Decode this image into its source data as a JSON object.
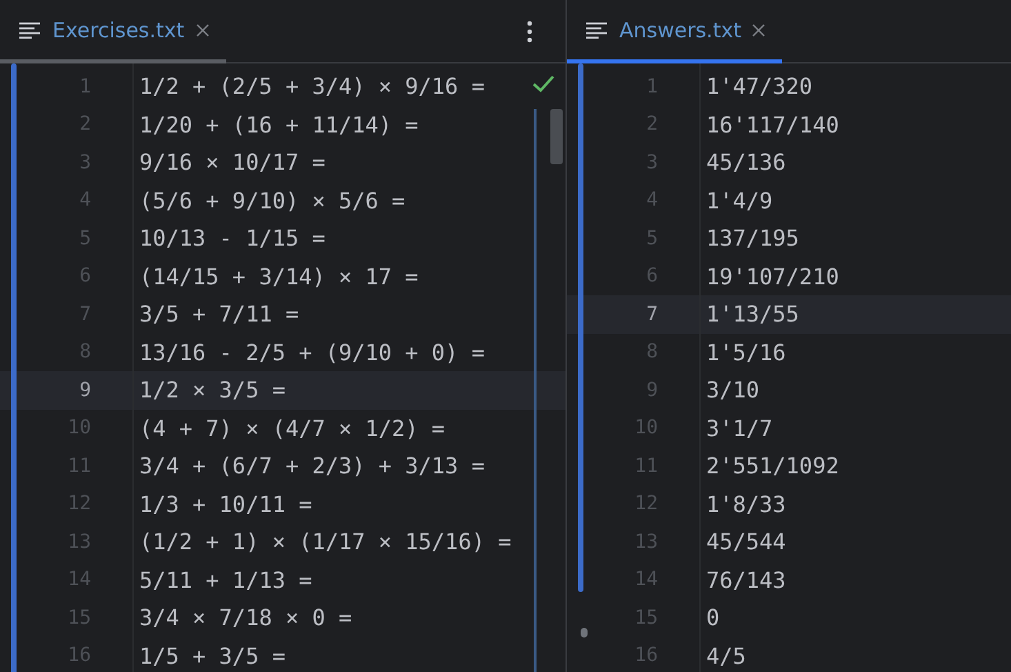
{
  "panes": [
    {
      "tab": {
        "label": "Exercises.txt",
        "focused": false
      },
      "more_menu": true,
      "inspection_ok": true,
      "lines": [
        {
          "number": "1",
          "text": "1/2 + (2/5 + 3/4) × 9/16 =",
          "current": false
        },
        {
          "number": "2",
          "text": "1/20 + (16 + 11/14) =",
          "current": false
        },
        {
          "number": "3",
          "text": "9/16 × 10/17 =",
          "current": false
        },
        {
          "number": "4",
          "text": "(5/6 + 9/10) × 5/6 =",
          "current": false
        },
        {
          "number": "5",
          "text": "10/13 - 1/15 =",
          "current": false
        },
        {
          "number": "6",
          "text": "(14/15 + 3/14) × 17 =",
          "current": false
        },
        {
          "number": "7",
          "text": "3/5 + 7/11 =",
          "current": false
        },
        {
          "number": "8",
          "text": "13/16 - 2/5 + (9/10 + 0) =",
          "current": false
        },
        {
          "number": "9",
          "text": "1/2 × 3/5 =",
          "current": true
        },
        {
          "number": "10",
          "text": "(4 + 7) × (4/7 × 1/2) =",
          "current": false
        },
        {
          "number": "11",
          "text": "3/4 + (6/7 + 2/3) + 3/13 =",
          "current": false
        },
        {
          "number": "12",
          "text": "1/3 + 10/11 =",
          "current": false
        },
        {
          "number": "13",
          "text": "(1/2 + 1) × (1/17 × 15/16) =",
          "current": false
        },
        {
          "number": "14",
          "text": "5/11 + 1/13 =",
          "current": false
        },
        {
          "number": "15",
          "text": "3/4 × 7/18 × 0 =",
          "current": false
        },
        {
          "number": "16",
          "text": "1/5 + 3/5 =",
          "current": false
        }
      ]
    },
    {
      "tab": {
        "label": "Answers.txt",
        "focused": true
      },
      "more_menu": false,
      "inspection_ok": false,
      "lines": [
        {
          "number": "1",
          "text": "1'47/320",
          "current": false
        },
        {
          "number": "2",
          "text": "16'117/140",
          "current": false
        },
        {
          "number": "3",
          "text": "45/136",
          "current": false
        },
        {
          "number": "4",
          "text": "1'4/9",
          "current": false
        },
        {
          "number": "5",
          "text": "137/195",
          "current": false
        },
        {
          "number": "6",
          "text": "19'107/210",
          "current": false
        },
        {
          "number": "7",
          "text": "1'13/55",
          "current": true
        },
        {
          "number": "8",
          "text": "1'5/16",
          "current": false
        },
        {
          "number": "9",
          "text": "3/10",
          "current": false
        },
        {
          "number": "10",
          "text": "3'1/7",
          "current": false
        },
        {
          "number": "11",
          "text": "2'551/1092",
          "current": false
        },
        {
          "number": "12",
          "text": "1'8/33",
          "current": false
        },
        {
          "number": "13",
          "text": "45/544",
          "current": false
        },
        {
          "number": "14",
          "text": "76/143",
          "current": false
        },
        {
          "number": "15",
          "text": "0",
          "current": false
        },
        {
          "number": "16",
          "text": "4/5",
          "current": false
        }
      ]
    }
  ]
}
